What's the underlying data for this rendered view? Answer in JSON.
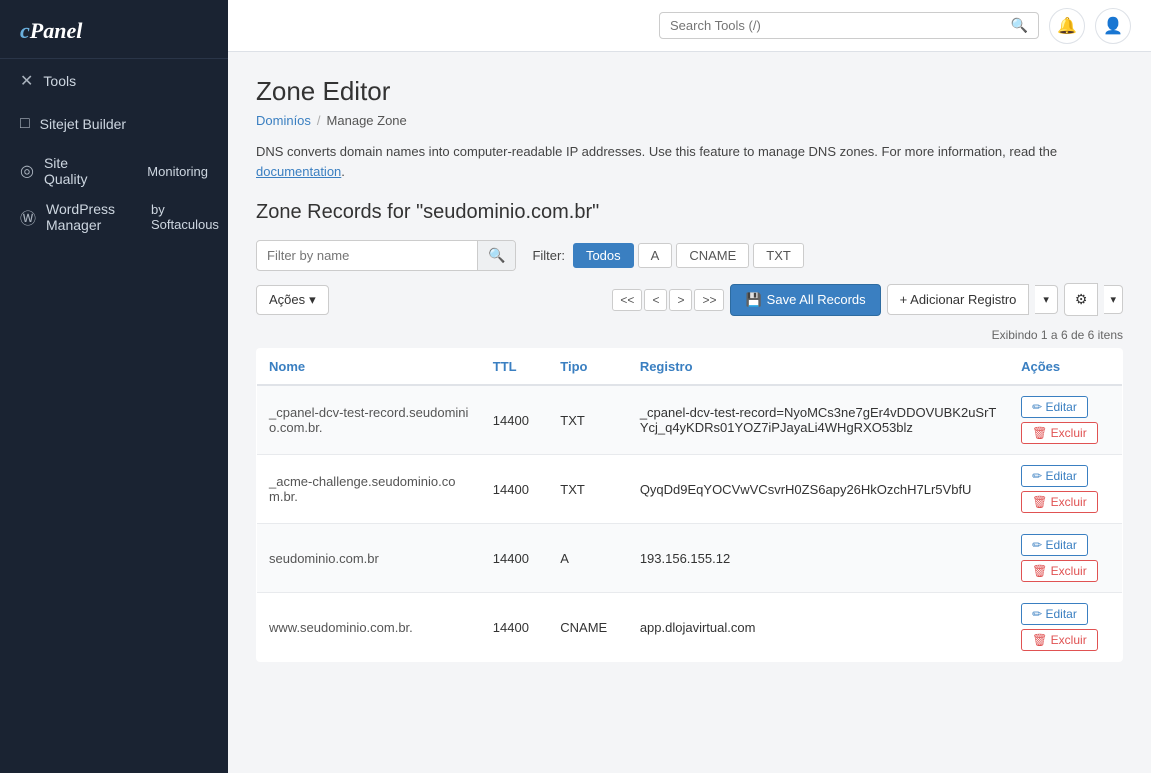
{
  "sidebar": {
    "logo": "cPanel",
    "items": [
      {
        "id": "tools",
        "label": "Tools",
        "icon": "✕"
      },
      {
        "id": "sitejet",
        "label": "Sitejet Builder",
        "icon": "□"
      },
      {
        "id": "site-quality",
        "label": "Site Quality",
        "sublabel": "Monitoring",
        "icon": "◎"
      },
      {
        "id": "wordpress",
        "label": "WordPress Manager",
        "sublabel": "by Softaculous",
        "icon": "Ⓦ"
      }
    ]
  },
  "header": {
    "search_placeholder": "Search Tools (/)",
    "search_icon": "search-icon",
    "bell_icon": "bell-icon",
    "user_icon": "user-icon"
  },
  "page": {
    "title": "Zone Editor",
    "breadcrumb": [
      {
        "label": "Dominíos",
        "href": "#"
      },
      {
        "label": "Manage Zone"
      }
    ],
    "description": "DNS converts domain names into computer-readable IP addresses. Use this feature to manage DNS zones. For more information, read the",
    "doc_link": "documentation",
    "zone_title": "Zone Records for \"seudominio.com.br\""
  },
  "filter": {
    "placeholder": "Filter by name",
    "label": "Filter:",
    "tabs": [
      {
        "id": "todos",
        "label": "Todos",
        "active": true
      },
      {
        "id": "a",
        "label": "A",
        "active": false
      },
      {
        "id": "cname",
        "label": "CNAME",
        "active": false
      },
      {
        "id": "txt",
        "label": "TXT",
        "active": false
      }
    ]
  },
  "actions": {
    "acoes_label": "Ações",
    "save_label": "Save All Records",
    "add_label": "+ Adicionar Registro",
    "pagination": {
      "first": "<<",
      "prev": "<",
      "next": ">",
      "last": ">>",
      "info": "Exibindo 1 a 6 de 6 itens"
    }
  },
  "table": {
    "columns": [
      "Nome",
      "TTL",
      "Tipo",
      "Registro",
      "Ações"
    ],
    "rows": [
      {
        "nome": "_cpanel-dcv-test-record.seudominio.com.br.",
        "ttl": "14400",
        "tipo": "TXT",
        "registro": "_cpanel-dcv-test-record=NyoMCs3ne7gEr4vDDOVUBK2uSrTYcj_q4yKDRs01YOZ7iPJayaLi4WHgRXO53blz",
        "is_a": false
      },
      {
        "nome": "_acme-challenge.seudominio.com.br.",
        "ttl": "14400",
        "tipo": "TXT",
        "registro": "QyqDd9EqYOCVwVCsvrH0ZS6apy26HkOzchH7Lr5VbfU",
        "is_a": false
      },
      {
        "nome": "seudominio.com.br",
        "ttl": "14400",
        "tipo": "A",
        "registro": "193.156.155.12",
        "is_a": true
      },
      {
        "nome": "www.seudominio.com.br.",
        "ttl": "14400",
        "tipo": "CNAME",
        "registro": "app.dlojavirtual.com",
        "is_a": false
      }
    ]
  },
  "buttons": {
    "editar": "✏ Editar",
    "excluir": "🗑 Excluir",
    "edit_icon": "edit-icon",
    "delete_icon": "trash-icon"
  }
}
